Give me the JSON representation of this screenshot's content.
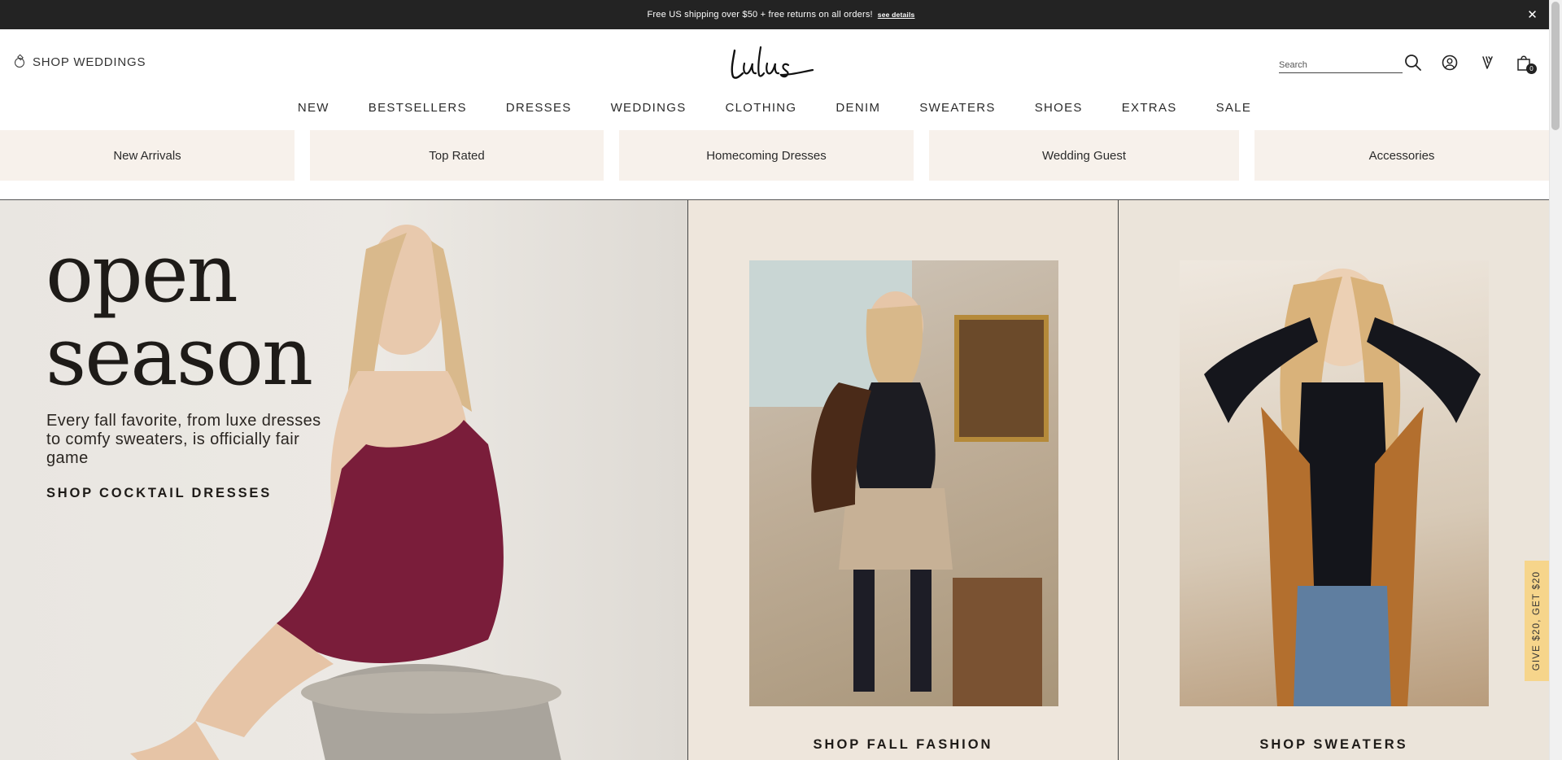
{
  "promo": {
    "text": "Free US shipping over $50 + free returns on all orders!",
    "link": "see details",
    "close": "✕"
  },
  "header": {
    "shop_weddings": "SHOP WEDDINGS",
    "logo_text": "Lulus",
    "search_placeholder": "Search",
    "cart_count": "0"
  },
  "nav": {
    "items": [
      "NEW",
      "BESTSELLERS",
      "DRESSES",
      "WEDDINGS",
      "CLOTHING",
      "DENIM",
      "SWEATERS",
      "SHOES",
      "EXTRAS",
      "SALE"
    ]
  },
  "tiles": [
    "New Arrivals",
    "Top Rated",
    "Homecoming Dresses",
    "Wedding Guest",
    "Accessories"
  ],
  "hero": {
    "headline_line1": "open",
    "headline_line2": "season",
    "subtext": "Every fall favorite, from luxe dresses to comfy sweaters, is officially fair game",
    "cta_main": "SHOP COCKTAIL DRESSES",
    "cta_fall": "SHOP FALL FASHION",
    "cta_sweaters": "SHOP SWEATERS"
  },
  "referral": "GIVE $20, GET $20"
}
